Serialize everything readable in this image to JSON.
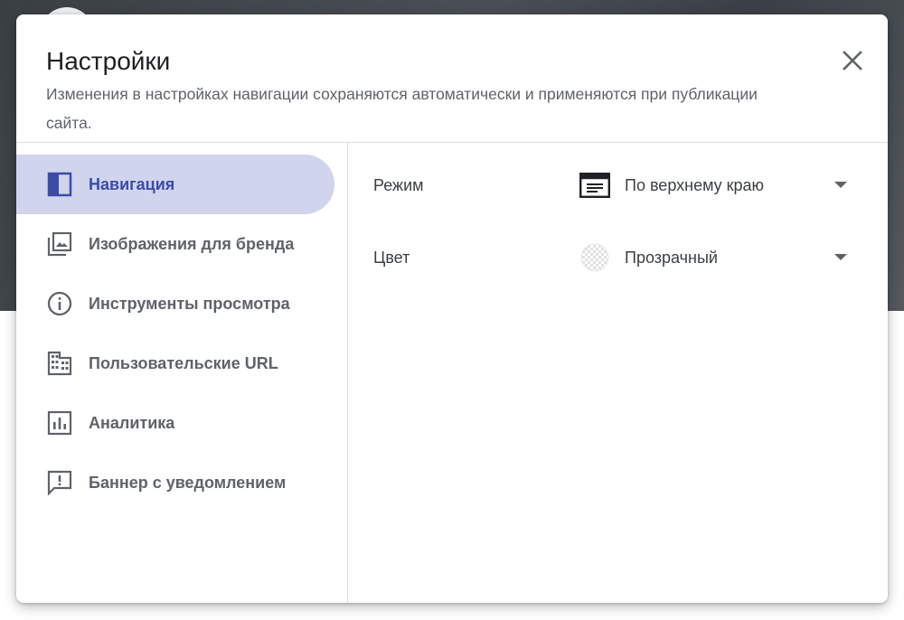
{
  "dialog": {
    "title": "Настройки",
    "subtitle": "Изменения в настройках навигации сохраняются автоматически и применяются при публикации сайта.",
    "close_icon": "close-icon"
  },
  "sidebar": {
    "items": [
      {
        "label": "Навигация",
        "icon": "navigation-panel-icon",
        "active": true
      },
      {
        "label": "Изображения для бренда",
        "icon": "image-icon",
        "active": false
      },
      {
        "label": "Инструменты просмотра",
        "icon": "info-icon",
        "active": false
      },
      {
        "label": "Пользовательские URL",
        "icon": "domain-icon",
        "active": false
      },
      {
        "label": "Аналитика",
        "icon": "analytics-icon",
        "active": false
      },
      {
        "label": "Баннер с уведомлением",
        "icon": "announcement-icon",
        "active": false
      }
    ]
  },
  "settings": {
    "mode": {
      "label": "Режим",
      "value": "По верхнему краю",
      "icon": "top-navigation-icon"
    },
    "color": {
      "label": "Цвет",
      "value": "Прозрачный",
      "icon": "transparent-swatch-icon"
    }
  },
  "colors": {
    "accent": "#3c4ba6",
    "active_bg": "#d0d4ec",
    "text_secondary": "#5f6368",
    "divider": "#dadce0"
  }
}
